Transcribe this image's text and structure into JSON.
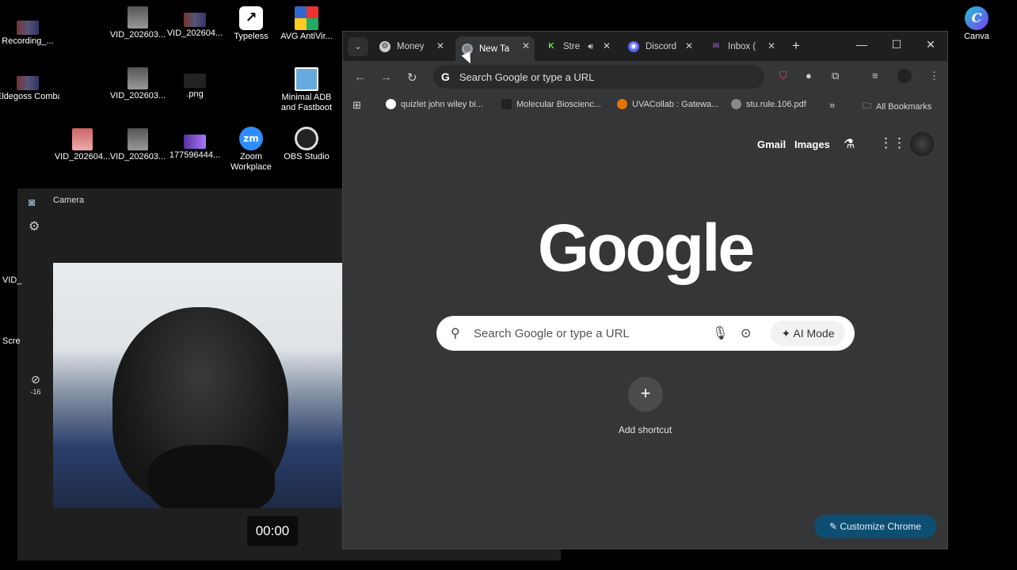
{
  "desktop": {
    "icons": [
      {
        "label": "Recording_...",
        "icon": "video-thumbnail-icon"
      },
      {
        "label": "VID_202603...",
        "icon": "video-thumbnail-icon"
      },
      {
        "label": "VID_202604...",
        "icon": "video-thumbnail-icon"
      },
      {
        "label": "Typeless",
        "icon": "typeless-app-icon"
      },
      {
        "label": "AVG AntiVir...",
        "icon": "avg-antivirus-icon"
      },
      {
        "label": "Eldegoss Combacnk...",
        "icon": "image-thumbnail-icon"
      },
      {
        "label": "VID_202603...",
        "icon": "video-thumbnail-icon"
      },
      {
        "label": ".png",
        "icon": "image-thumbnail-icon"
      },
      {
        "label": "Minimal ADB and Fastboot",
        "icon": "adb-app-icon"
      },
      {
        "label": "VID_202604...",
        "icon": "video-thumbnail-icon"
      },
      {
        "label": "VID_202603...",
        "icon": "video-thumbnail-icon"
      },
      {
        "label": "177596444...",
        "icon": "image-thumbnail-icon"
      },
      {
        "label": "Zoom Workplace",
        "icon": "zoom-app-icon"
      },
      {
        "label": "OBS Studio",
        "icon": "obs-app-icon"
      },
      {
        "label": "Canva",
        "icon": "canva-app-icon"
      }
    ],
    "clipped_labels": [
      "VID_",
      "Scre"
    ]
  },
  "camera": {
    "title": "Camera",
    "exposure_value": "-16",
    "timer": "00:00"
  },
  "chrome": {
    "tabs": [
      {
        "label": "Money",
        "icon": "settings-tab-icon"
      },
      {
        "label": "New Ta",
        "icon": "chrome-tab-icon",
        "active": true
      },
      {
        "label": "Stre",
        "icon": "kick-tab-icon"
      },
      {
        "label": "Discord",
        "icon": "discord-tab-icon"
      },
      {
        "label": "Inbox (",
        "icon": "mail-tab-icon"
      }
    ],
    "new_tab_symbol": "+",
    "omnibox_placeholder": "Search Google or type a URL",
    "bookmarks": [
      {
        "label": "quizlet john wiley bi...",
        "icon": "google-favicon"
      },
      {
        "label": "Molecular Bioscienc...",
        "icon": "shield-favicon"
      },
      {
        "label": "UVACollab : Gatewa...",
        "icon": "uva-favicon"
      },
      {
        "label": "stu.rule.106.pdf",
        "icon": "globe-favicon"
      }
    ],
    "all_bookmarks": "All Bookmarks",
    "ntp": {
      "gmail": "Gmail",
      "images": "Images",
      "logo": "Google",
      "search_placeholder": "Search Google or type a URL",
      "ai_mode": "AI Mode",
      "add_shortcut": "Add shortcut",
      "customize": "Customize Chrome"
    }
  },
  "colors": {
    "chrome_bg": "#353638",
    "tabstrip_bg": "#1f1f20",
    "customize_bg": "#0e4e73"
  }
}
